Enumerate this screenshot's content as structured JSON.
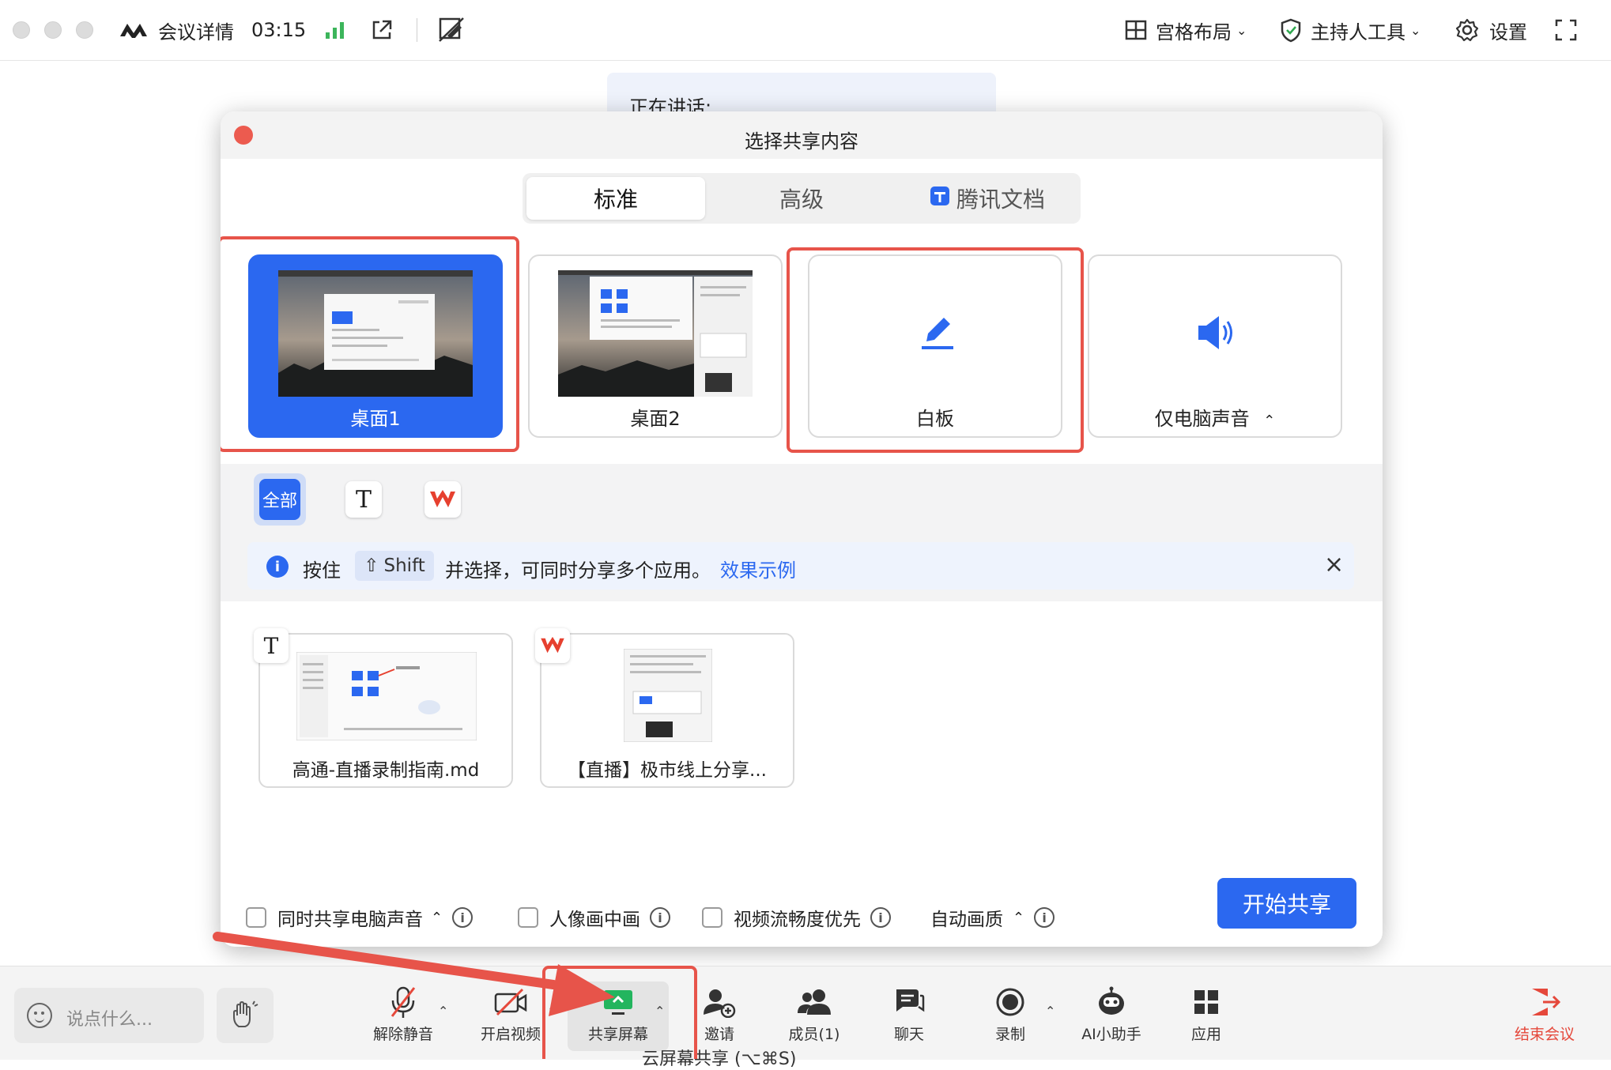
{
  "topbar": {
    "meeting_details": "会议详情",
    "timer": "03:15",
    "grid_layout": "宫格布局",
    "host_tools": "主持人工具",
    "settings": "设置"
  },
  "stage": {
    "speaking_label": "正在讲话:"
  },
  "dialog": {
    "title": "选择共享内容",
    "tabs": [
      "标准",
      "高级",
      "腾讯文档"
    ],
    "sources": [
      {
        "label": "桌面1",
        "selected": true
      },
      {
        "label": "桌面2",
        "selected": false
      },
      {
        "label": "白板",
        "selected": false
      },
      {
        "label": "仅电脑声音",
        "selected": false
      }
    ],
    "filters": {
      "all": "全部"
    },
    "hint": {
      "prefix": "按住",
      "key": "Shift",
      "body": "并选择，可同时分享多个应用。",
      "link": "效果示例"
    },
    "apps": [
      {
        "label": "高通-直播录制指南.md"
      },
      {
        "label": "【直播】极市线上分享..."
      }
    ],
    "options": {
      "share_audio": "同时共享电脑声音",
      "pip": "人像画中画",
      "smooth": "视频流畅度优先",
      "quality": "自动画质"
    },
    "start_button": "开始共享"
  },
  "bottombar": {
    "chat_placeholder": "说点什么...",
    "unmute": "解除静音",
    "video": "开启视频",
    "share": "共享屏幕",
    "invite": "邀请",
    "members": "成员(1)",
    "chat": "聊天",
    "record": "录制",
    "ai": "AI小助手",
    "apps": "应用",
    "end": "结束会议",
    "tooltip_fragment": "云屏幕共享 (⌥⌘S)"
  },
  "colors": {
    "accent": "#2b68f0",
    "highlight_red": "#e7544a",
    "end_red": "#e5483b"
  }
}
